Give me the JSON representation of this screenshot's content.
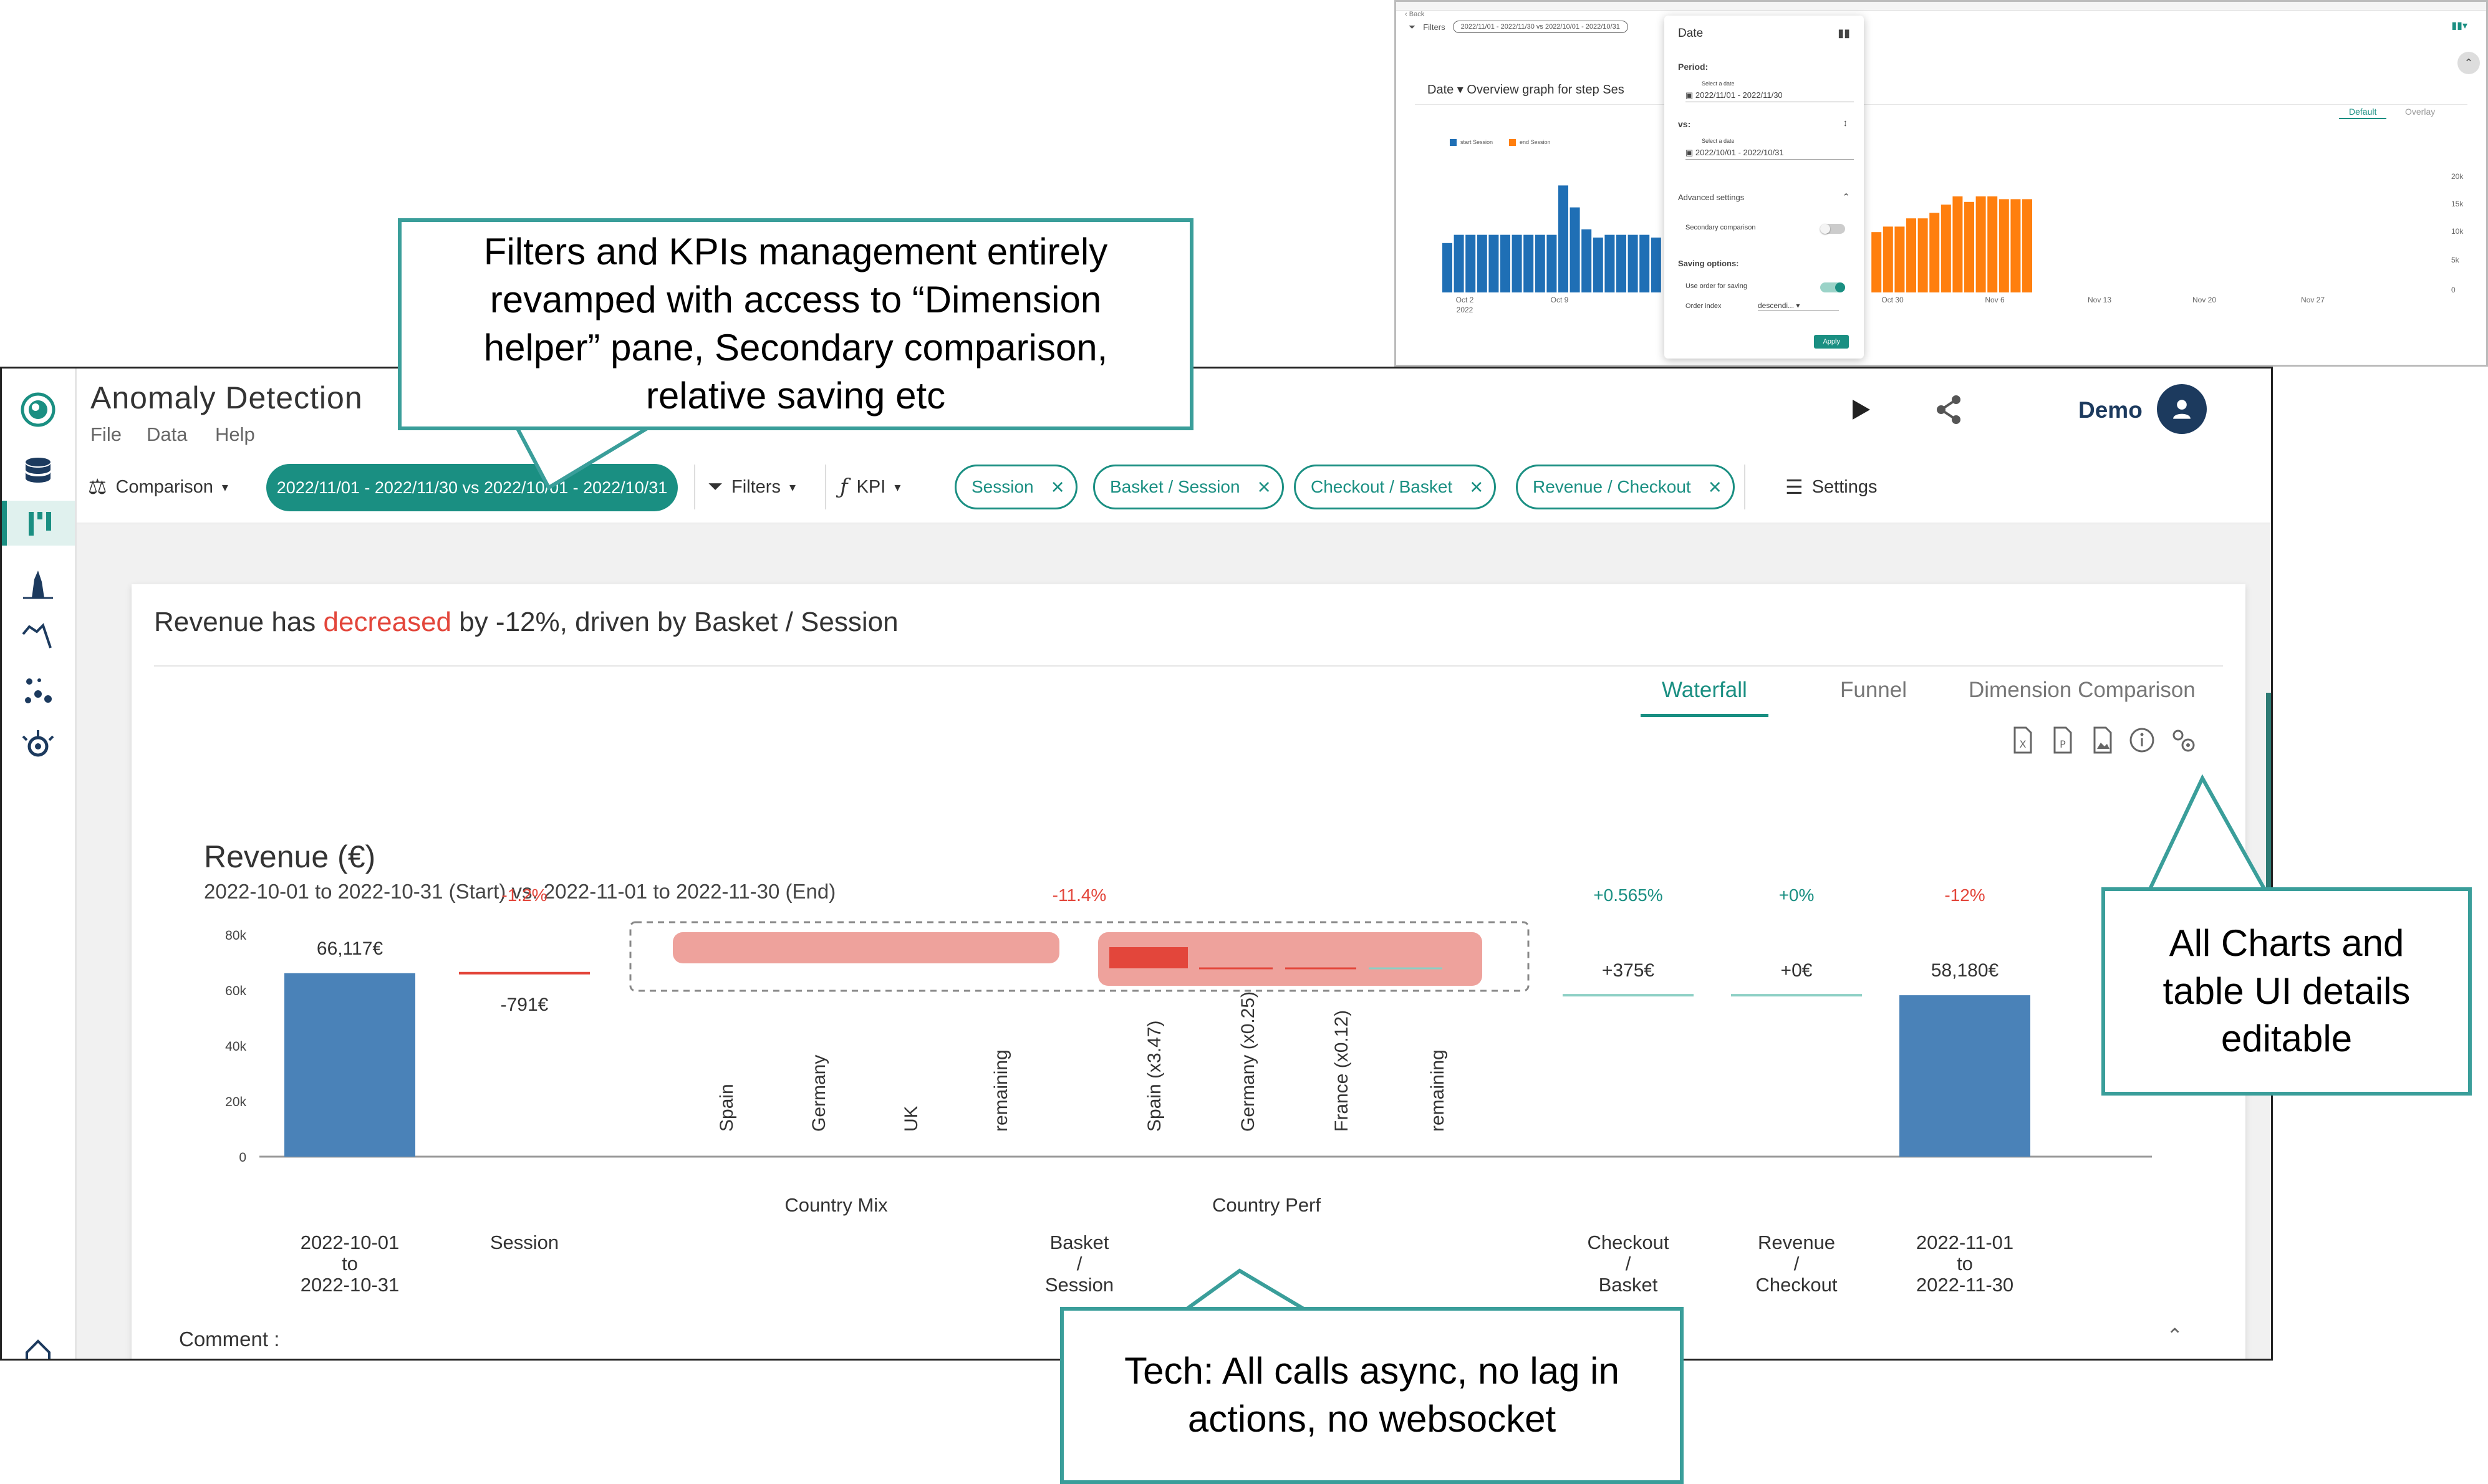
{
  "app": {
    "title": "Anomaly Detection",
    "menu": [
      "File",
      "Data",
      "Help"
    ],
    "user_name": "Demo"
  },
  "sidebar": {
    "icons": [
      "logo-icon",
      "database-icon",
      "waterfall-icon",
      "histogram-icon",
      "trend-icon",
      "scatter-icon",
      "settings-bug-icon",
      "home-icon"
    ]
  },
  "toolbar": {
    "comparison_label": "Comparison",
    "date_range": "2022/11/01 - 2022/11/30 vs 2022/10/01 - 2022/10/31",
    "filters_label": "Filters",
    "kpi_label": "KPI",
    "kpi_pills": [
      "Session",
      "Basket / Session",
      "Checkout / Basket",
      "Revenue / Checkout"
    ],
    "settings_label": "Settings"
  },
  "card": {
    "headline_prefix": "Revenue has ",
    "headline_highlight": "decreased",
    "headline_suffix": " by -12%, driven by Basket / Session",
    "tabs": [
      "Waterfall",
      "Funnel",
      "Dimension Comparison"
    ],
    "active_tab": "Waterfall",
    "comment_label": "Comment :"
  },
  "chart_data": {
    "type": "waterfall",
    "title": "Revenue (€)",
    "subtitle": "2022-10-01 to 2022-10-31 (Start) vs. 2022-11-01 to 2022-11-30 (End)",
    "y_ticks": [
      "0",
      "20k",
      "40k",
      "60k",
      "80k"
    ],
    "ylim": [
      0,
      80000
    ],
    "steps": [
      {
        "label_lines": [
          "2022-10-01",
          "to",
          "2022-10-31"
        ],
        "value_label": "66,117€",
        "pct_label": "",
        "value": 66117,
        "kind": "total"
      },
      {
        "label_lines": [
          "Session"
        ],
        "value_label": "-791€",
        "pct_label": "-1.2%",
        "value": -791,
        "kind": "delta"
      },
      {
        "label_lines": [
          "Basket",
          "/",
          "Session"
        ],
        "value_label": "",
        "pct_label": "-11.4%",
        "value": -7521,
        "kind": "delta-group"
      },
      {
        "label_lines": [
          "Checkout",
          "/",
          "Basket"
        ],
        "value_label": "+375€",
        "pct_label": "+0.565%",
        "value": 375,
        "kind": "delta"
      },
      {
        "label_lines": [
          "Revenue",
          "/",
          "Checkout"
        ],
        "value_label": "+0€",
        "pct_label": "+0%",
        "value": 0,
        "kind": "delta"
      },
      {
        "label_lines": [
          "2022-11-01",
          "to",
          "2022-11-30"
        ],
        "value_label": "58,180€",
        "pct_label": "-12%",
        "value": 58180,
        "kind": "total"
      }
    ],
    "sub_groups": [
      {
        "name": "Country Mix",
        "items": [
          "Spain",
          "Germany",
          "UK",
          "remaining"
        ]
      },
      {
        "name": "Country Perf",
        "items": [
          "Spain (x3.47)",
          "Germany (x0.25)",
          "France (x0.12)",
          "remaining"
        ]
      }
    ],
    "colors": {
      "total": "#4a82b8",
      "negative": "#e3463b",
      "negative_light": "#eea29c",
      "positive": "#8ccfc4",
      "pct_negative": "#e3463b",
      "pct_positive": "#1a8f82"
    }
  },
  "callouts": {
    "top": "Filters and KPIs management entirely revamped with access to “Dimension helper” pane, Secondary comparison, relative saving etc",
    "right": "All Charts and table UI details editable",
    "bottom": "Tech: All calls async, no lag in actions, no websocket"
  },
  "inset": {
    "back_label": "Back",
    "filters_label": "Filters",
    "filter_pill": "2022/11/01 - 2022/11/30 vs 2022/10/01 - 2022/10/31",
    "graph_title": "Date ▾  Overview graph for step Ses",
    "toggle_default": "Default",
    "toggle_overlay": "Overlay",
    "legend": [
      "start Session",
      "end Session"
    ],
    "x_labels": [
      "Oct 2\n2022",
      "Oct 9",
      "Oct 30",
      "Nov 6",
      "Nov 13",
      "Nov 20",
      "Nov 27"
    ],
    "y_labels": [
      "20k",
      "15k",
      "10k",
      "5k",
      "0"
    ],
    "blue_bars": [
      36,
      42,
      42,
      42,
      42,
      42,
      42,
      42,
      42,
      42,
      78,
      62,
      46,
      40,
      42,
      42,
      42
    ],
    "orange_bars_left": [],
    "blue_bars_right": [
      42,
      40,
      40,
      40
    ],
    "orange_bars": [
      40,
      44,
      44,
      46,
      46,
      44,
      44,
      44,
      44,
      44,
      44,
      70,
      44,
      44,
      44,
      44,
      44,
      48,
      48,
      54,
      54,
      58,
      64,
      70,
      66,
      70,
      70,
      68,
      68,
      68
    ],
    "popup": {
      "title": "Date",
      "period_label": "Period:",
      "period_hint": "Select a date",
      "period_value": "2022/11/01 - 2022/11/30",
      "vs_label": "vs:",
      "vs_hint": "Select a date",
      "vs_value": "2022/10/01 - 2022/10/31",
      "advanced_label": "Advanced settings",
      "secondary_label": "Secondary comparison",
      "saving_label": "Saving options:",
      "use_order_label": "Use order for saving",
      "order_index_label": "Order index",
      "order_index_value": "descendi...",
      "apply_label": "Apply"
    }
  }
}
